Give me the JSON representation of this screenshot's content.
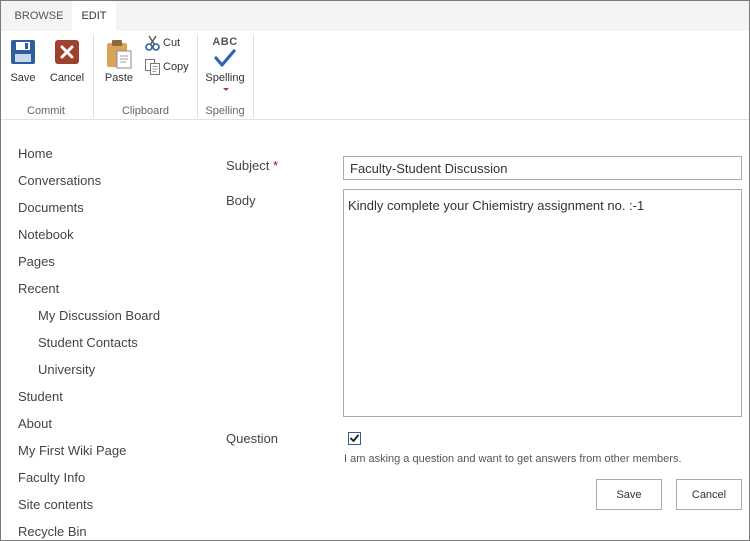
{
  "ribbon": {
    "tabs": [
      {
        "label": "BROWSE",
        "active": false
      },
      {
        "label": "EDIT",
        "active": true
      }
    ],
    "groups": {
      "commit": {
        "name": "Commit",
        "save_label": "Save",
        "cancel_label": "Cancel"
      },
      "clipboard": {
        "name": "Clipboard",
        "paste_label": "Paste",
        "cut_label": "Cut",
        "copy_label": "Copy"
      },
      "spelling": {
        "name": "Spelling",
        "spelling_label": "Spelling",
        "abc_text": "ABC"
      }
    }
  },
  "nav": {
    "items": [
      {
        "label": "Home",
        "level": 0
      },
      {
        "label": "Conversations",
        "level": 0
      },
      {
        "label": "Documents",
        "level": 0
      },
      {
        "label": "Notebook",
        "level": 0
      },
      {
        "label": "Pages",
        "level": 0
      },
      {
        "label": "Recent",
        "level": 0
      },
      {
        "label": "My Discussion Board",
        "level": 1
      },
      {
        "label": "Student Contacts",
        "level": 1
      },
      {
        "label": "University",
        "level": 1
      },
      {
        "label": "Student",
        "level": 0
      },
      {
        "label": "About",
        "level": 0
      },
      {
        "label": "My First Wiki Page",
        "level": 0
      },
      {
        "label": "Faculty Info",
        "level": 0
      },
      {
        "label": "Site contents",
        "level": 0
      },
      {
        "label": "Recycle Bin",
        "level": 0
      }
    ]
  },
  "form": {
    "subject_label": "Subject",
    "required_marker": " *",
    "subject_value": "Faculty-Student Discussion",
    "body_label": "Body",
    "body_value": "Kindly complete your Chiemistry assignment no. :-1",
    "question_label": "Question",
    "question_checked": true,
    "question_hint": "I am asking a question and want to get answers from other members.",
    "save_label": "Save",
    "cancel_label": "Cancel"
  },
  "colors": {
    "save_icon": "#2f5e9e",
    "cancel_icon": "#a0412d",
    "spelling_check": "#2f66b3",
    "required": "#bf0000"
  }
}
